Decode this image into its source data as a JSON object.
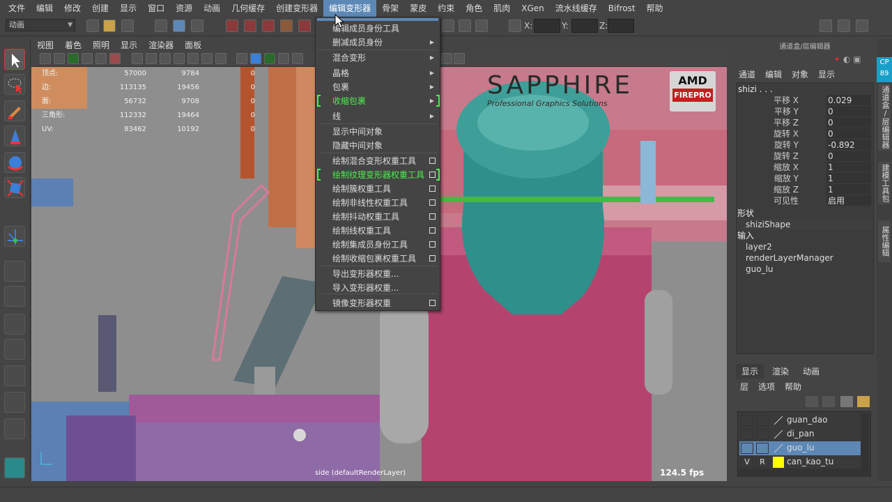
{
  "menubar": [
    "文件",
    "编辑",
    "修改",
    "创建",
    "显示",
    "窗口",
    "资源",
    "动画",
    "几何缓存",
    "创建变形器",
    "编辑变形器",
    "骨架",
    "蒙皮",
    "约束",
    "角色",
    "肌肉",
    "XGen",
    "流水线缓存",
    "Bifrost",
    "帮助"
  ],
  "active_menu_index": 10,
  "mode_selector": "动画",
  "coord_labels": {
    "x": "X:",
    "y": "Y:",
    "z": "Z:"
  },
  "viewport_menu": [
    "视图",
    "着色",
    "照明",
    "显示",
    "渲染器",
    "面板"
  ],
  "hud": [
    {
      "k": "顶点:",
      "a": "57000",
      "b": "9784",
      "c": "0"
    },
    {
      "k": "边:",
      "a": "113135",
      "b": "19456",
      "c": "0"
    },
    {
      "k": "面:",
      "a": "56732",
      "b": "9708",
      "c": "0"
    },
    {
      "k": "三角形:",
      "a": "112332",
      "b": "19464",
      "c": "0"
    },
    {
      "k": "UV:",
      "a": "83462",
      "b": "10192",
      "c": "0"
    }
  ],
  "camera_label": "side (defaultRenderLayer)",
  "fps": "124.5 fps",
  "sapphire": {
    "logo": "SAPPHIRE",
    "tagline": "Professional Graphics Solutions",
    "amd": "AMD",
    "firepro": "FIREPRO"
  },
  "dropdown": [
    {
      "label": "编辑成员身份工具"
    },
    {
      "label": "删减成员身份",
      "sub": true
    },
    {
      "label": "混合变形",
      "sub": true
    },
    {
      "label": "晶格",
      "sub": true
    },
    {
      "label": "包裹",
      "sub": true
    },
    {
      "label": "收缩包裹",
      "sub": true,
      "green": true,
      "bracket": true
    },
    {
      "label": "线",
      "sub": true
    },
    {
      "label": "显示中间对象"
    },
    {
      "label": "隐藏中间对象"
    },
    {
      "label": "绘制混合变形权重工具",
      "box": true
    },
    {
      "label": "绘制纹理变形器权重工具",
      "box": true,
      "green": true,
      "bracket": true
    },
    {
      "label": "绘制簇权重工具",
      "box": true
    },
    {
      "label": "绘制非线性权重工具",
      "box": true
    },
    {
      "label": "绘制抖动权重工具",
      "box": true
    },
    {
      "label": "绘制线权重工具",
      "box": true
    },
    {
      "label": "绘制集成员身份工具",
      "box": true
    },
    {
      "label": "绘制收缩包裹权重工具",
      "box": true
    },
    {
      "label": "导出变形器权重..."
    },
    {
      "label": "导入变形器权重..."
    },
    {
      "label": "镜像变形器权重",
      "box": true
    }
  ],
  "channel_box": {
    "title": "通道盒/层编辑器",
    "menu": [
      "通道",
      "编辑",
      "对象",
      "显示"
    ],
    "object": "shizi . . .",
    "attrs": [
      {
        "label": "平移 X",
        "value": "0.029"
      },
      {
        "label": "平移 Y",
        "value": "0"
      },
      {
        "label": "平移 Z",
        "value": "0"
      },
      {
        "label": "旋转 X",
        "value": "0"
      },
      {
        "label": "旋转 Y",
        "value": "-0.892"
      },
      {
        "label": "旋转 Z",
        "value": "0"
      },
      {
        "label": "缩放 X",
        "value": "1"
      },
      {
        "label": "缩放 Y",
        "value": "1"
      },
      {
        "label": "缩放 Z",
        "value": "1"
      },
      {
        "label": "可见性",
        "value": "启用"
      }
    ],
    "shapes_header": "形状",
    "shape": "shiziShape",
    "inputs_header": "输入",
    "inputs": [
      "layer2",
      "renderLayerManager",
      "guo_lu"
    ]
  },
  "layer_editor": {
    "tabs": [
      "显示",
      "渲染",
      "动画"
    ],
    "menu": [
      "层",
      "选项",
      "帮助"
    ],
    "layers": [
      {
        "name": "guan_dao",
        "v": "",
        "r": "",
        "selected": false,
        "color": ""
      },
      {
        "name": "di_pan",
        "v": "",
        "r": "",
        "selected": false,
        "color": ""
      },
      {
        "name": "guo_lu",
        "v": "",
        "r": "",
        "selected": true,
        "color": ""
      },
      {
        "name": "can_kao_tu",
        "v": "V",
        "r": "R",
        "selected": false,
        "color": "#ffff00"
      }
    ]
  },
  "side_tabs": [
    "通道盒/层编辑器",
    "建模工具包",
    "属性编辑器"
  ],
  "side_badge": "CP 89"
}
